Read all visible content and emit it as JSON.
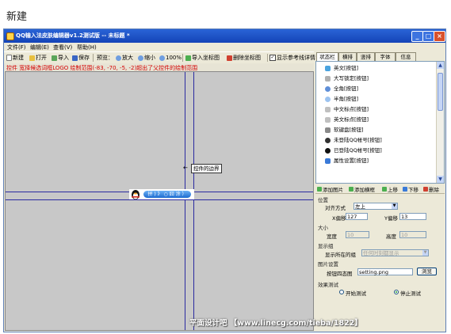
{
  "caption": "新建",
  "window": {
    "title": "QQ输入法皮肤编辑器v1.2测试版 -- 未标题 *",
    "controls": {
      "minimize": "_",
      "maximize": "□",
      "close": "×"
    }
  },
  "menu": [
    "文件(F)",
    "编辑(E)",
    "查看(V)",
    "帮助(H)"
  ],
  "toolbar": {
    "new": "新建",
    "open": "打开",
    "import": "导入",
    "save": "保存",
    "preview_label": "预览：",
    "zoom_in": "放大",
    "zoom_out": "缩小",
    "zoom_100": "100%",
    "import_coords": "导入坐标图",
    "delete_coords": "删除坐标图",
    "show_ref": "显示参考线详情"
  },
  "status_text": "控件  宽择候选词框LOGO  绘制范围(-83, -70, -5, -2)超出了父控件的绘制范围",
  "canvas": {
    "tooltip": "控件的边界",
    "arrow": "←",
    "candidate_text": "拼 ) 》 ○ 囧 涂 ）",
    "watermark": "平面设计吧  【www.linecg.com/tieba/1822】"
  },
  "tabs": [
    "状态栏",
    "横排",
    "竖排",
    "字体",
    "信息"
  ],
  "active_tab": 0,
  "control_list": [
    "英文[按钮]",
    "大写锁定[按钮]",
    "全角[按钮]",
    "半角[按钮]",
    "中文标点[按钮]",
    "英文标点[按钮]",
    "软键盘[按钮]",
    "未登陆QQ帐号[按钮]",
    "已登陆QQ帐号[按钮]",
    "属性设置[按钮]"
  ],
  "list_actions": {
    "add_image": "添加图片",
    "add_bar": "添加横框",
    "move_up": "上移",
    "move_down": "下移",
    "delete": "删除"
  },
  "props": {
    "position_group": "位置",
    "align_label": "对齐方式",
    "align_value": "左上",
    "x_offset_label": "X偏移",
    "x_offset_value": "127",
    "y_offset_label": "Y偏移",
    "y_offset_value": "13",
    "size_group": "大小",
    "width_label": "宽度",
    "width_value": "10",
    "height_label": "高度",
    "height_value": "10",
    "display_group": "显示组",
    "display_group_label": "显示所在的组",
    "display_group_value": "任何时刻都显示",
    "image_group": "图片设置",
    "button_image_label": "按钮四态图",
    "button_image_value": "setting.png",
    "browse": "浏览",
    "effect_group": "效果测试",
    "start_test": "开始测试",
    "stop_test": "停止测试"
  },
  "colors": {
    "title_bar": "#1a4fc4",
    "canvas": "#c8c8c8",
    "guide_line": "#2a2aa0",
    "status_text": "#d40000"
  }
}
